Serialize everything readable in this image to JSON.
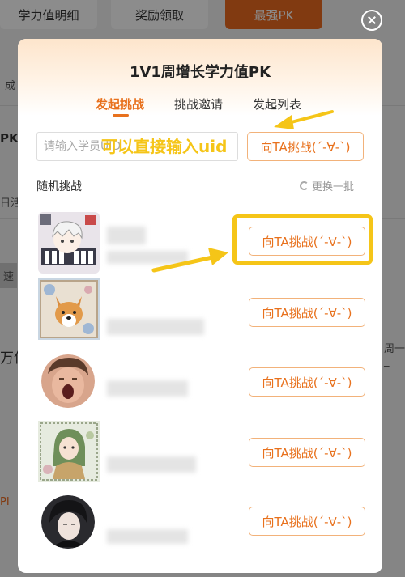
{
  "background": {
    "tabs": [
      "学力值明细",
      "奖励领取",
      "最强PK"
    ],
    "fragments": [
      "成",
      "PK",
      "日活",
      "速",
      "万亿",
      "周一_",
      "PI"
    ]
  },
  "modal": {
    "title": "1V1周增长学力值PK",
    "tabs": [
      {
        "label": "发起挑战",
        "active": true
      },
      {
        "label": "挑战邀请",
        "active": false
      },
      {
        "label": "发起列表",
        "active": false
      }
    ],
    "uid_input": {
      "placeholder": "请输入学员UID",
      "value": ""
    },
    "challenge_button_label": "向TA挑战(´-∀-`)",
    "random_label": "随机挑战",
    "refresh_label": "更换一批",
    "candidates": [
      {
        "avatar": "anime-character-avatar",
        "button": "向TA挑战(´-∀-`)"
      },
      {
        "avatar": "corgi-dog-avatar",
        "button": "向TA挑战(´-∀-`)"
      },
      {
        "avatar": "person-photo-avatar",
        "button": "向TA挑战(´-∀-`)"
      },
      {
        "avatar": "illustrated-girl-avatar",
        "button": "向TA挑战(´-∀-`)"
      },
      {
        "avatar": "person-portrait-avatar",
        "button": "向TA挑战(´-∀-`)"
      }
    ]
  },
  "annotation": {
    "text": "可以直接输入uid",
    "color": "#f5c518"
  },
  "colors": {
    "accent": "#e8711d",
    "annotation": "#f5c518"
  }
}
